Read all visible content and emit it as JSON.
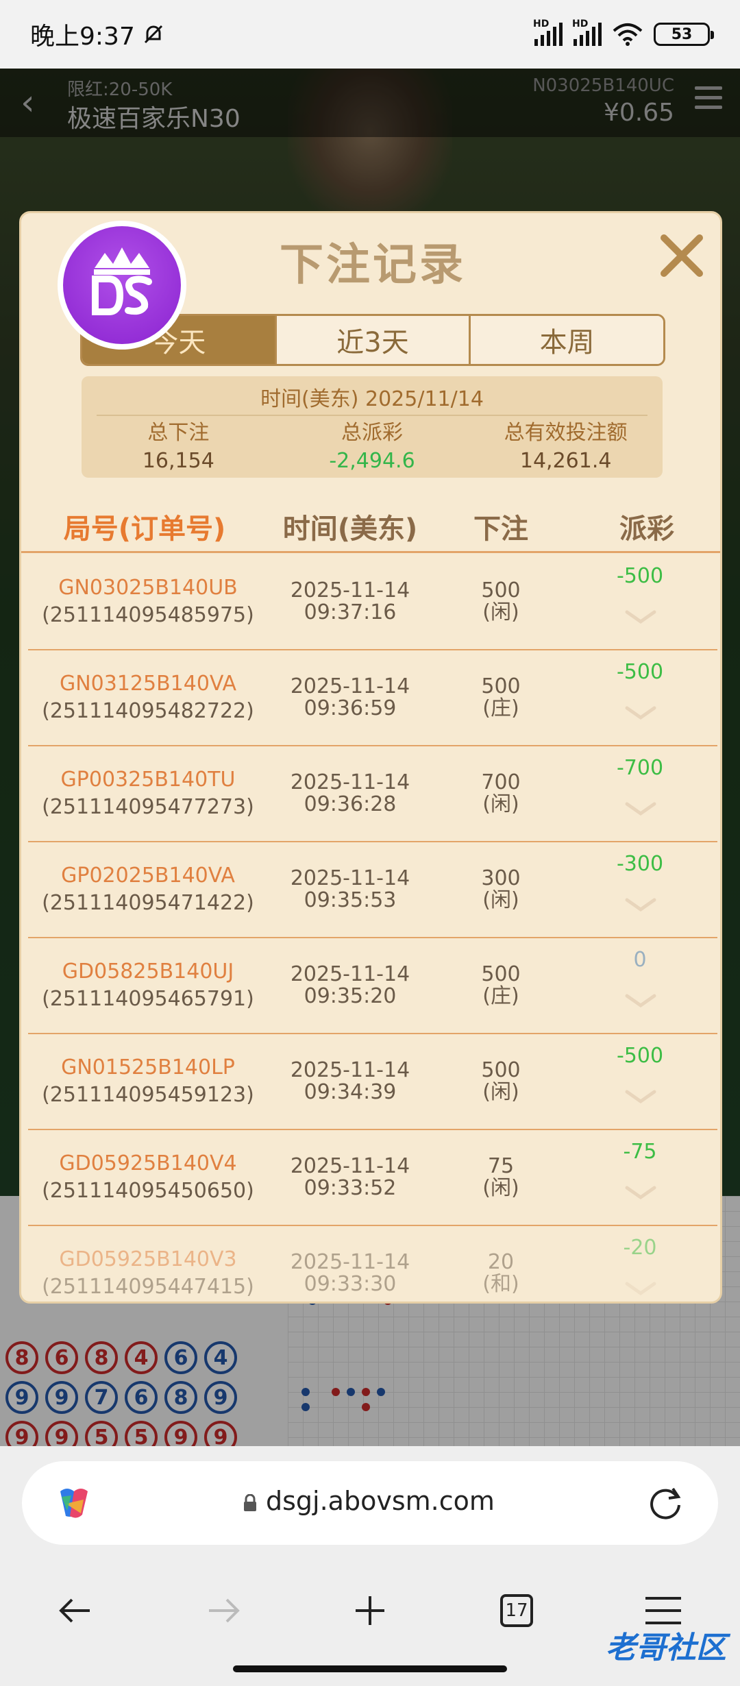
{
  "status_bar": {
    "time": "晚上9:37",
    "battery": "53",
    "hd_label": "HD"
  },
  "game": {
    "limit": "限红:20-50K",
    "title": "极速百家乐N30",
    "round_id": "N03025B140UC",
    "balance": "¥0.65",
    "roadmap_numbers": [
      "8",
      "6",
      "8",
      "4",
      "6",
      "4",
      "9",
      "9",
      "7",
      "6",
      "8",
      "9",
      "9",
      "9",
      "5",
      "5",
      "9",
      "9"
    ]
  },
  "modal": {
    "title": "下注记录",
    "tabs": [
      {
        "label": "今天",
        "active": true
      },
      {
        "label": "近3天",
        "active": false
      },
      {
        "label": "本周",
        "active": false
      }
    ],
    "summary": {
      "date_line": "时间(美东) 2025/11/14",
      "total_bet_label": "总下注",
      "total_bet": "16,154",
      "total_payout_label": "总派彩",
      "total_payout": "-2,494.6",
      "valid_bet_label": "总有效投注额",
      "valid_bet": "14,261.4"
    },
    "headers": {
      "id": "局号(订单号)",
      "time": "时间(美东)",
      "bet": "下注",
      "payout": "派彩"
    },
    "rows": [
      {
        "id": "GN03025B140UB",
        "order": "(251114095485975)",
        "date": "2025-11-14",
        "time": "09:37:16",
        "amount": "500",
        "side": "(闲)",
        "payout": "-500"
      },
      {
        "id": "GN03125B140VA",
        "order": "(251114095482722)",
        "date": "2025-11-14",
        "time": "09:36:59",
        "amount": "500",
        "side": "(庄)",
        "payout": "-500"
      },
      {
        "id": "GP00325B140TU",
        "order": "(251114095477273)",
        "date": "2025-11-14",
        "time": "09:36:28",
        "amount": "700",
        "side": "(闲)",
        "payout": "-700"
      },
      {
        "id": "GP02025B140VA",
        "order": "(251114095471422)",
        "date": "2025-11-14",
        "time": "09:35:53",
        "amount": "300",
        "side": "(闲)",
        "payout": "-300"
      },
      {
        "id": "GD05825B140UJ",
        "order": "(251114095465791)",
        "date": "2025-11-14",
        "time": "09:35:20",
        "amount": "500",
        "side": "(庄)",
        "payout": "0"
      },
      {
        "id": "GN01525B140LP",
        "order": "(251114095459123)",
        "date": "2025-11-14",
        "time": "09:34:39",
        "amount": "500",
        "side": "(闲)",
        "payout": "-500"
      },
      {
        "id": "GD05925B140V4",
        "order": "(251114095450650)",
        "date": "2025-11-14",
        "time": "09:33:52",
        "amount": "75",
        "side": "(闲)",
        "payout": "-75"
      },
      {
        "id": "GD05925B140V3",
        "order": "(251114095447415)",
        "date": "2025-11-14",
        "time": "09:33:30",
        "amount": "20",
        "side": "(和)",
        "payout": "-20"
      }
    ]
  },
  "browser": {
    "url": "dsgj.abovsm.com",
    "tab_count": "17"
  },
  "watermark": {
    "text": "老哥社区"
  },
  "colors": {
    "modal_bg": "#f7ead2",
    "accent_gold": "#a87f3f",
    "negative_green": "#3dbd45",
    "id_orange": "#e08040"
  }
}
